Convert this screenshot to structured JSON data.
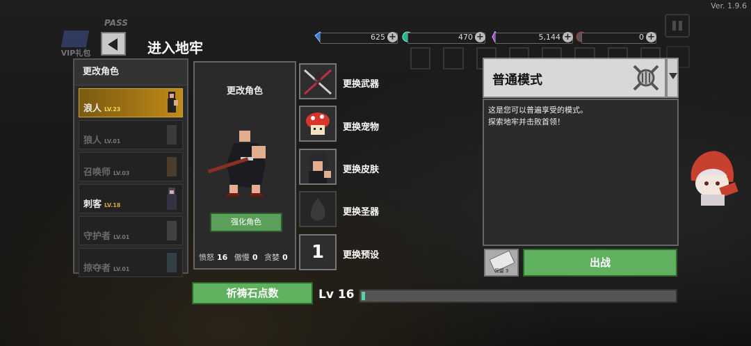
{
  "version": "Ver. 1.9.6",
  "ghost": {
    "pass_label": "PASS",
    "vip_label": "VIP礼包",
    "currencies": [
      "625",
      "470",
      "5,144",
      "0"
    ]
  },
  "currencies": [
    {
      "icon": "diamond-icon",
      "value": "625",
      "color": "#3a7ddc"
    },
    {
      "icon": "green-orb-icon",
      "value": "470",
      "color": "#2ab38f"
    },
    {
      "icon": "purple-crystal-icon",
      "value": "5,144",
      "color": "#a04ad8"
    },
    {
      "icon": "dark-stone-icon",
      "value": "0",
      "color": "#666666"
    }
  ],
  "header": {
    "title": "进入地牢"
  },
  "character_list": {
    "title": "更改角色",
    "items": [
      {
        "name": "浪人",
        "level": "LV.23",
        "state": "selected"
      },
      {
        "name": "狼人",
        "level": "LV.01",
        "state": "locked"
      },
      {
        "name": "召唤师",
        "level": "LV.03",
        "state": "locked"
      },
      {
        "name": "刺客",
        "level": "LV.18",
        "state": "unlocked"
      },
      {
        "name": "守护者",
        "level": "LV.01",
        "state": "locked"
      },
      {
        "name": "掠夺者",
        "level": "LV.01",
        "state": "locked"
      }
    ]
  },
  "character_card": {
    "label": "更改角色",
    "upgrade_label": "强化角色",
    "stats": [
      {
        "label": "愤怒",
        "value": "16"
      },
      {
        "label": "傲慢",
        "value": "0"
      },
      {
        "label": "贪婪",
        "value": "0"
      }
    ]
  },
  "slots": [
    {
      "label": "更换武器",
      "icon": "crossed-swords-icon"
    },
    {
      "label": "更换宠物",
      "icon": "mushroom-pet-icon"
    },
    {
      "label": "更换皮肤",
      "icon": "ronin-portrait-icon"
    },
    {
      "label": "更换圣器",
      "icon": "relic-silhouette-icon"
    },
    {
      "label": "更换预设",
      "value": "1"
    }
  ],
  "mode": {
    "title": "普通模式",
    "description": [
      "这是您可以普遍享受的模式。",
      "探索地牢并击败首领！"
    ]
  },
  "ticket": {
    "label": "保留 3"
  },
  "fight_label": "出战",
  "pray_label": "祈祷石点数",
  "level": {
    "label": "Lv 16",
    "progress": 0.01
  }
}
